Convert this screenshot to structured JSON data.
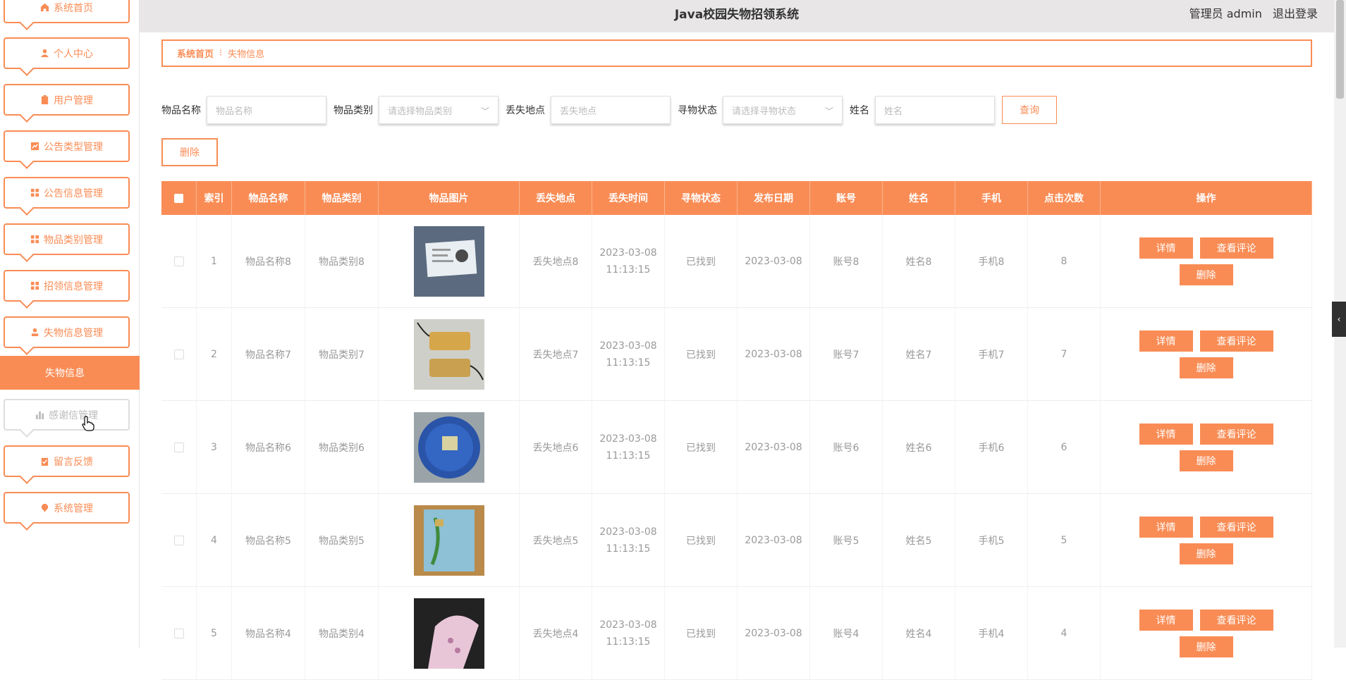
{
  "app": {
    "title": "Java校园失物招领系统",
    "user": "管理员 admin",
    "logout": "退出登录"
  },
  "sidebar": {
    "items": [
      {
        "label": "系统首页",
        "icon": "home-icon"
      },
      {
        "label": "个人中心",
        "icon": "user-icon"
      },
      {
        "label": "用户管理",
        "icon": "clipboard-icon"
      },
      {
        "label": "公告类型管理",
        "icon": "chart-icon"
      },
      {
        "label": "公告信息管理",
        "icon": "grid-icon"
      },
      {
        "label": "物品类别管理",
        "icon": "grid-icon"
      },
      {
        "label": "招领信息管理",
        "icon": "grid-icon"
      },
      {
        "label": "失物信息管理",
        "icon": "person-icon"
      },
      {
        "label": "感谢信管理",
        "icon": "bar-chart-icon"
      },
      {
        "label": "留言反馈",
        "icon": "clipboard-icon"
      },
      {
        "label": "系统管理",
        "icon": "pin-icon"
      }
    ],
    "active_sub": "失物信息"
  },
  "breadcrumb": {
    "home": "系统首页",
    "current": "失物信息"
  },
  "search": {
    "name_label": "物品名称",
    "name_placeholder": "物品名称",
    "type_label": "物品类别",
    "type_placeholder": "请选择物品类别",
    "place_label": "丢失地点",
    "place_placeholder": "丢失地点",
    "status_label": "寻物状态",
    "status_placeholder": "请选择寻物状态",
    "person_label": "姓名",
    "person_placeholder": "姓名",
    "query": "查询"
  },
  "delete_label": "删除",
  "table": {
    "headers": [
      "索引",
      "物品名称",
      "物品类别",
      "物品图片",
      "丢失地点",
      "丢失时间",
      "寻物状态",
      "发布日期",
      "账号",
      "姓名",
      "手机",
      "点击次数",
      "操作"
    ],
    "rows": [
      {
        "idx": "1",
        "name": "物品名称8",
        "type": "物品类别8",
        "place": "丢失地点8",
        "date": "2023-03-08",
        "time": "11:13:15",
        "status": "已找到",
        "pub": "2023-03-08",
        "acct": "账号8",
        "person": "姓名8",
        "phone": "手机8",
        "clicks": "8"
      },
      {
        "idx": "2",
        "name": "物品名称7",
        "type": "物品类别7",
        "place": "丢失地点7",
        "date": "2023-03-08",
        "time": "11:13:15",
        "status": "已找到",
        "pub": "2023-03-08",
        "acct": "账号7",
        "person": "姓名7",
        "phone": "手机7",
        "clicks": "7"
      },
      {
        "idx": "3",
        "name": "物品名称6",
        "type": "物品类别6",
        "place": "丢失地点6",
        "date": "2023-03-08",
        "time": "11:13:15",
        "status": "已找到",
        "pub": "2023-03-08",
        "acct": "账号6",
        "person": "姓名6",
        "phone": "手机6",
        "clicks": "6"
      },
      {
        "idx": "4",
        "name": "物品名称5",
        "type": "物品类别5",
        "place": "丢失地点5",
        "date": "2023-03-08",
        "time": "11:13:15",
        "status": "已找到",
        "pub": "2023-03-08",
        "acct": "账号5",
        "person": "姓名5",
        "phone": "手机5",
        "clicks": "5"
      },
      {
        "idx": "5",
        "name": "物品名称4",
        "type": "物品类别4",
        "place": "丢失地点4",
        "date": "2023-03-08",
        "time": "11:13:15",
        "status": "已找到",
        "pub": "2023-03-08",
        "acct": "账号4",
        "person": "姓名4",
        "phone": "手机4",
        "clicks": "4"
      }
    ],
    "ops": {
      "detail": "详情",
      "comments": "查看评论",
      "delete": "删除"
    }
  },
  "colors": {
    "accent": "#f98c55",
    "header_bg": "#e8e6e6"
  }
}
